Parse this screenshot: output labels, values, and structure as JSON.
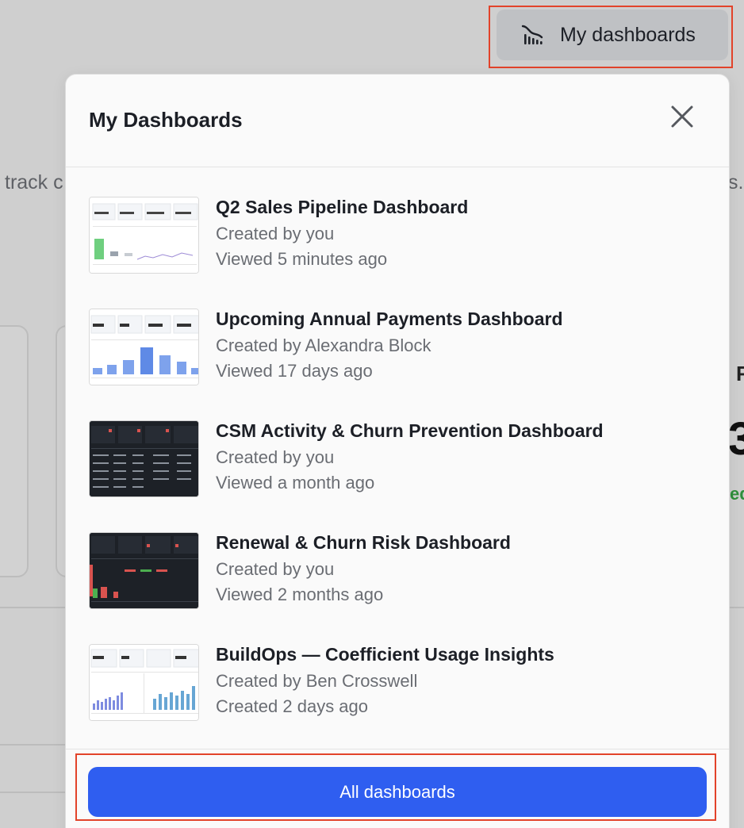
{
  "background": {
    "left_text": "track c",
    "right_text": "s.",
    "fragment_r": "R",
    "fragment_big": "3",
    "fragment_green": "ed"
  },
  "top_button": {
    "label": "My dashboards",
    "icon": "dashboard-chart-icon"
  },
  "panel": {
    "title": "My Dashboards",
    "close_icon": "close-icon",
    "items": [
      {
        "title": "Q2 Sales Pipeline Dashboard",
        "meta1": "Created by you",
        "meta2": "Viewed 5 minutes ago",
        "theme": "light-green"
      },
      {
        "title": "Upcoming Annual Payments Dashboard",
        "meta1": "Created by Alexandra Block",
        "meta2": "Viewed 17 days ago",
        "theme": "light-blue"
      },
      {
        "title": "CSM Activity & Churn Prevention Dashboard",
        "meta1": "Created by you",
        "meta2": "Viewed a month ago",
        "theme": "dark-table"
      },
      {
        "title": "Renewal & Churn Risk Dashboard",
        "meta1": "Created by you",
        "meta2": "Viewed 2 months ago",
        "theme": "dark-bars"
      },
      {
        "title": "BuildOps — Coefficient Usage Insights",
        "meta1": "Created by Ben Crosswell",
        "meta2": "Created 2 days ago",
        "theme": "light-multi"
      }
    ],
    "all_button_label": "All dashboards"
  },
  "colors": {
    "accent_blue": "#2f5ef0",
    "highlight_red": "#e2432a",
    "overlay_gray": "#cfcfcf"
  }
}
